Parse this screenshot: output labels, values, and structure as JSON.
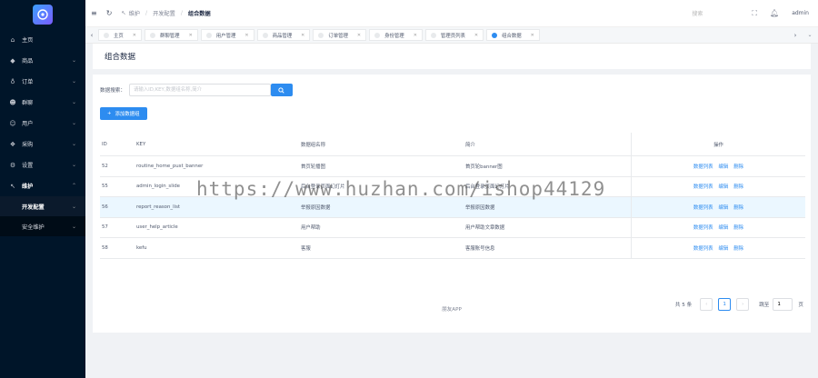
{
  "sidebar": {
    "items": [
      {
        "icon": "home-icon",
        "glyph": "⌂",
        "label": "主页"
      },
      {
        "icon": "goods-icon",
        "glyph": "◆",
        "label": "商品"
      },
      {
        "icon": "cart-icon",
        "glyph": "♁",
        "label": "订单"
      },
      {
        "icon": "users-icon",
        "glyph": "☻",
        "label": "群聊"
      },
      {
        "icon": "user-icon",
        "glyph": "☺",
        "label": "用户"
      },
      {
        "icon": "cart2-icon",
        "glyph": "❖",
        "label": "采购"
      },
      {
        "icon": "gear-icon",
        "glyph": "⚙",
        "label": "设置"
      },
      {
        "icon": "wrench-icon",
        "glyph": "↖",
        "label": "维护"
      }
    ],
    "submenu": [
      {
        "label": "开发配置"
      },
      {
        "label": "安全维护"
      }
    ]
  },
  "header": {
    "breadcrumb": [
      "维护",
      "开发配置",
      "组合数据"
    ],
    "search_placeholder": "搜索",
    "user": "admin"
  },
  "tabs": [
    "主页",
    "群聊管理",
    "用户管理",
    "商品管理",
    "订单管理",
    "身份管理",
    "管理员列表",
    "组合数据"
  ],
  "page": {
    "title": "组合数据",
    "search_label": "数据搜索：",
    "search_placeholder": "请输入ID,KEY,数据组名称,简介",
    "add_button": "添加数据组"
  },
  "table": {
    "headers": {
      "id": "ID",
      "key": "KEY",
      "name": "数据组名称",
      "desc": "简介",
      "op": "操作"
    },
    "rows": [
      {
        "id": "52",
        "key": "routine_home_pust_banner",
        "name": "首页轮播图",
        "desc": "首页轮banner图"
      },
      {
        "id": "55",
        "key": "admin_login_slide",
        "name": "后台登录页面幻灯片",
        "desc": "后台登录页面幻灯片"
      },
      {
        "id": "56",
        "key": "report_reason_list",
        "name": "举报原因数据",
        "desc": "举报原因数据"
      },
      {
        "id": "57",
        "key": "user_help_article",
        "name": "用户帮助",
        "desc": "用户帮助文章数据"
      },
      {
        "id": "58",
        "key": "kefu",
        "name": "客服",
        "desc": "客服账号信息"
      }
    ],
    "ops": {
      "list": "数据列表",
      "edit": "编辑",
      "delete": "删除"
    }
  },
  "pager": {
    "total": "共 5 条",
    "current": "1",
    "jump_label": "跳至",
    "jump_value": "1",
    "unit": "页"
  },
  "footer": "朋友APP",
  "watermark": "https://www.huzhan.com/ishop44129"
}
